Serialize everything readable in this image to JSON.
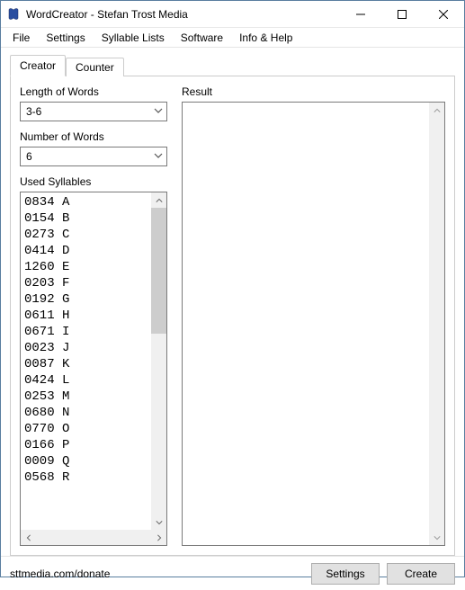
{
  "window": {
    "title": "WordCreator - Stefan Trost Media"
  },
  "menu": {
    "items": [
      "File",
      "Settings",
      "Syllable Lists",
      "Software",
      "Info & Help"
    ]
  },
  "tabs": {
    "creator": "Creator",
    "counter": "Counter"
  },
  "left": {
    "length_label": "Length of Words",
    "length_value": "3-6",
    "count_label": "Number of Words",
    "count_value": "6",
    "syllables_label": "Used Syllables",
    "syllables": [
      "0834 A",
      "0154 B",
      "0273 C",
      "0414 D",
      "1260 E",
      "0203 F",
      "0192 G",
      "0611 H",
      "0671 I",
      "0023 J",
      "0087 K",
      "0424 L",
      "0253 M",
      "0680 N",
      "0770 O",
      "0166 P",
      "0009 Q",
      "0568 R"
    ]
  },
  "right": {
    "result_label": "Result",
    "result_text": ""
  },
  "footer": {
    "link": "sttmedia.com/donate",
    "settings": "Settings",
    "create": "Create"
  }
}
